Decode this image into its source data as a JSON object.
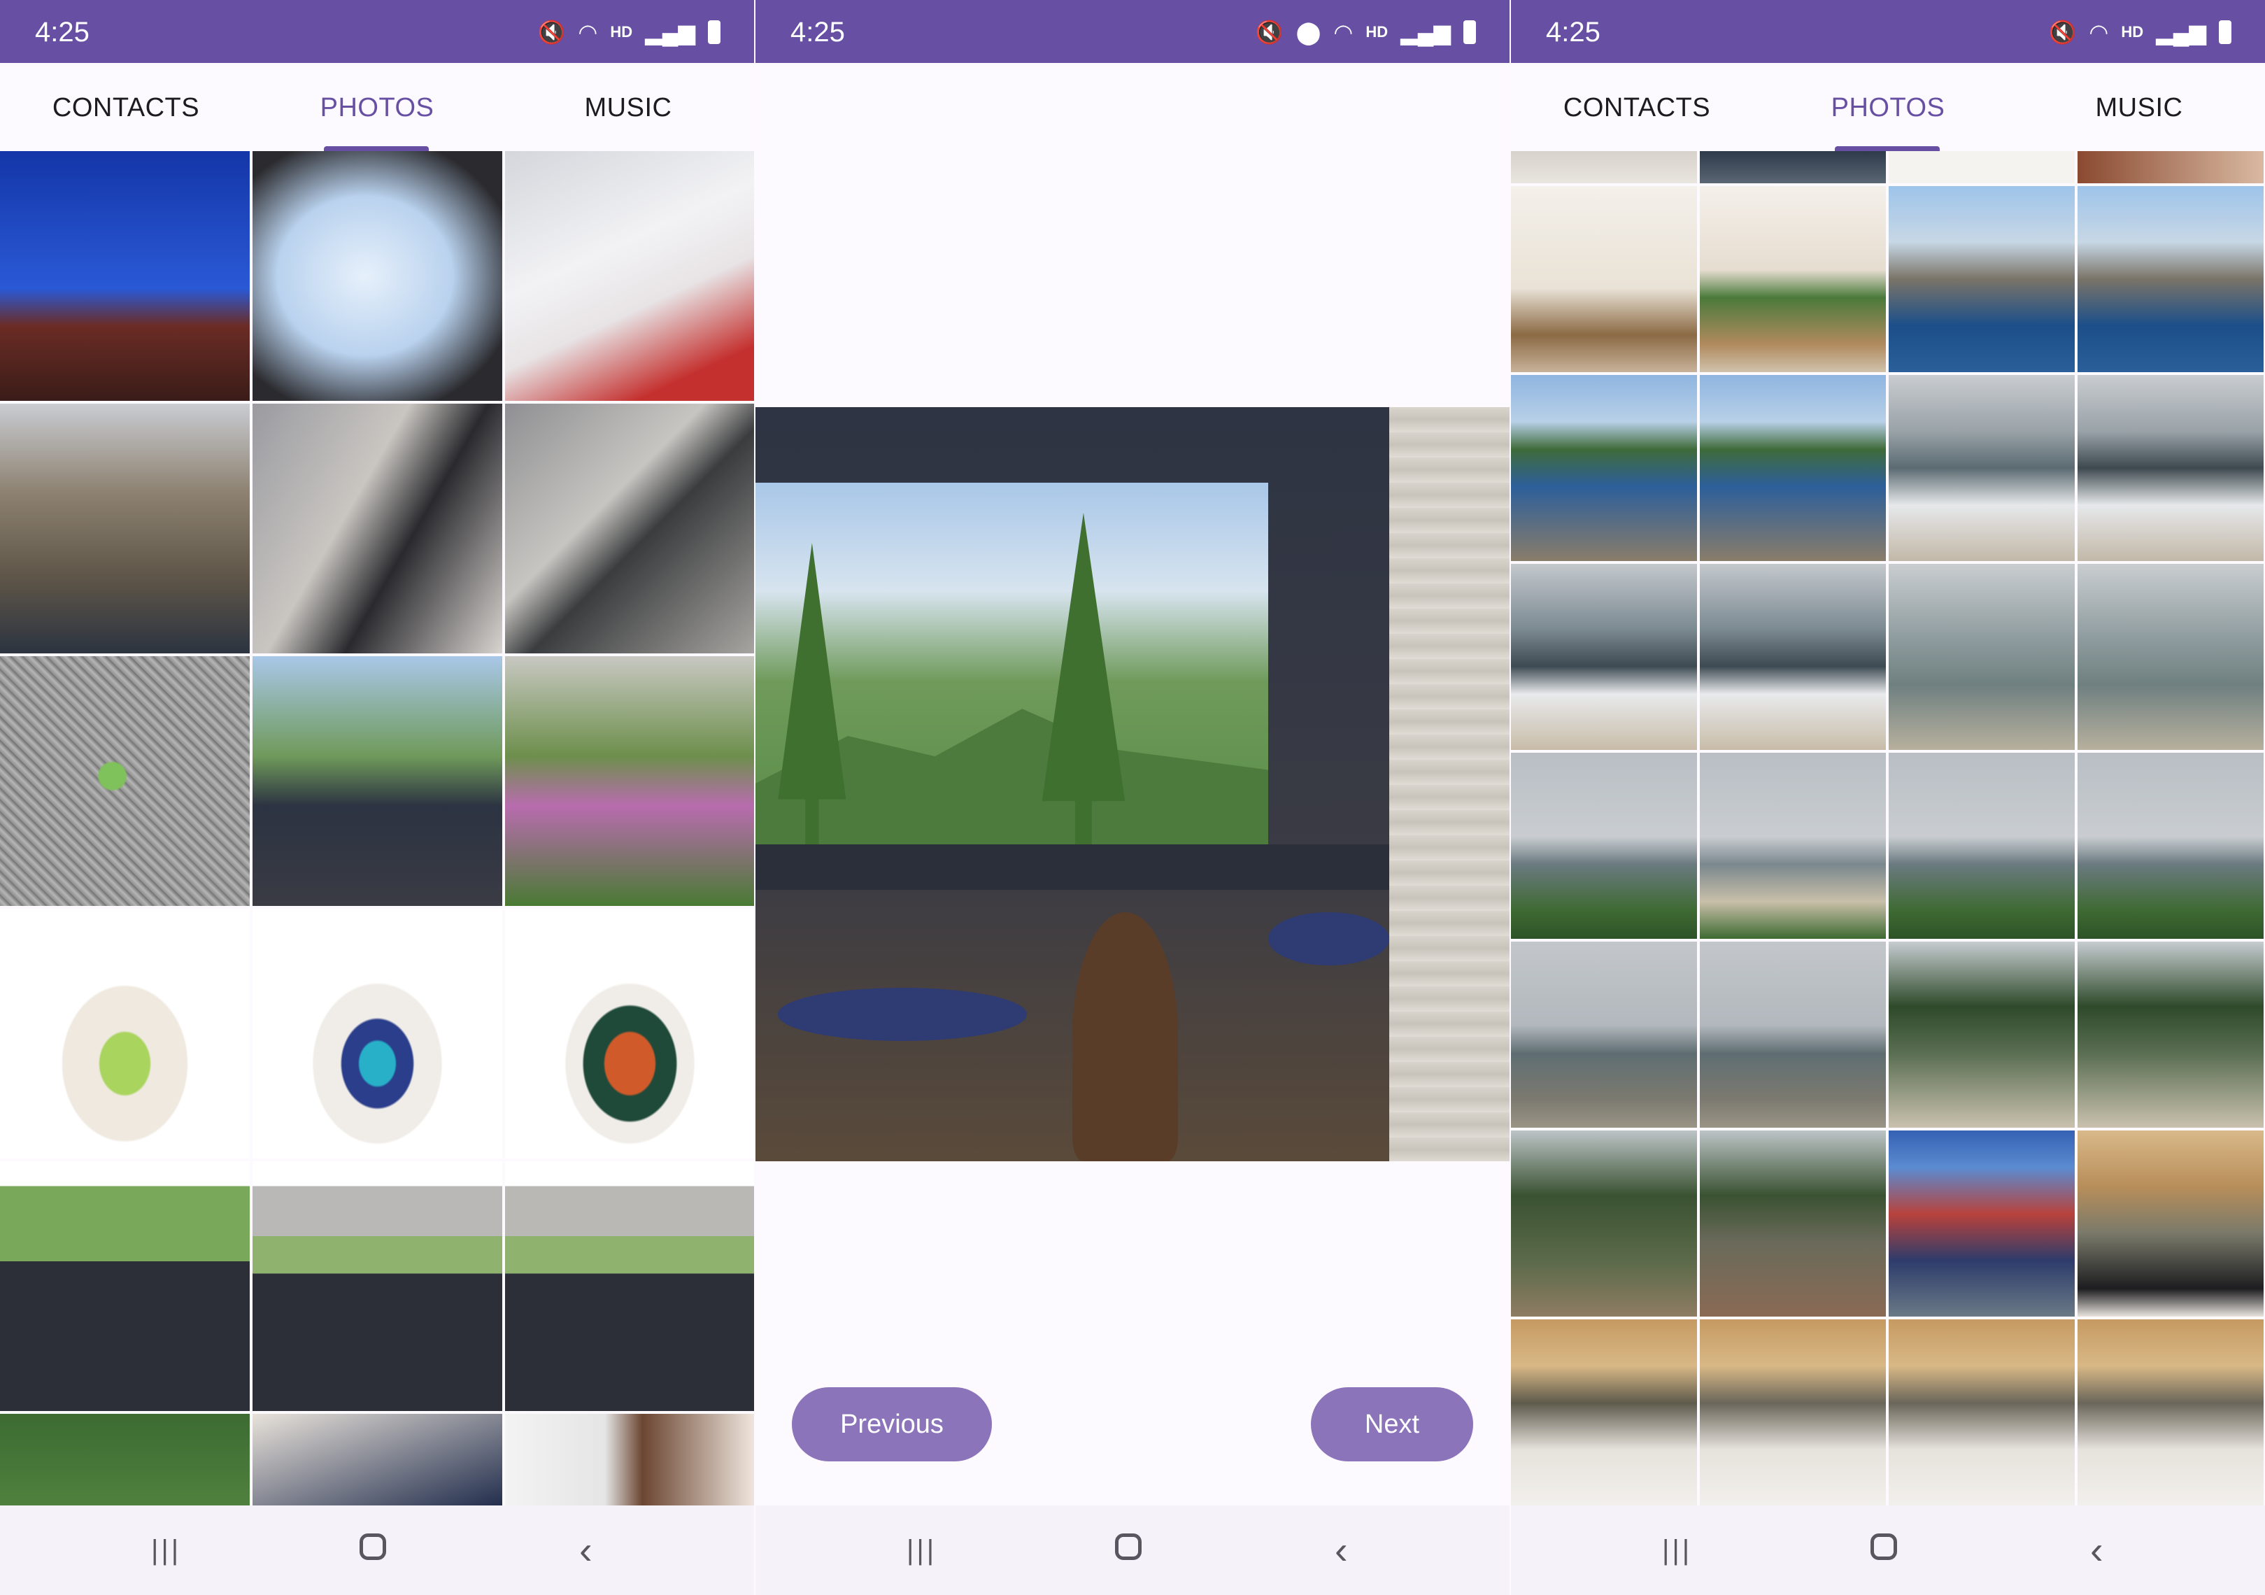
{
  "status_bar": {
    "time": "4:25",
    "hd_label": "HD",
    "icons": [
      "mute-icon",
      "location-icon",
      "wifi-icon",
      "hd-voice-icon",
      "signal-icon",
      "battery-icon"
    ]
  },
  "tabs": [
    {
      "label": "CONTACTS"
    },
    {
      "label": "PHOTOS"
    },
    {
      "label": "MUSIC"
    }
  ],
  "active_tab": "PHOTOS",
  "viewer": {
    "previous_label": "Previous",
    "next_label": "Next"
  },
  "nav_bar": {
    "icons": [
      "recents-icon",
      "home-icon",
      "back-icon"
    ]
  },
  "colors": {
    "brand": "#6750a4",
    "button": "#8c74bb",
    "background": "#fdfaff"
  },
  "phone1_photos": [
    "theater-stage",
    "casting-board",
    "ticket",
    "college-building",
    "girl-balcony",
    "floor-mat",
    "green-frog",
    "window-mountain",
    "garden-flowers",
    "sandal-green",
    "sandal-blue",
    "sandal-orange",
    "car-driver",
    "car-peace-sign",
    "car-interior",
    "forest-window",
    "girl-desk",
    "girl-wall"
  ],
  "phone3_photos": [
    "partial-top-1",
    "partial-top-2",
    "partial-top-3",
    "partial-top-4",
    "cafe-interior-1",
    "cafe-interior-2",
    "sea-rocks-1",
    "sea-rocks-2",
    "rocky-shore-1",
    "rocky-shore-2",
    "waves-rocks-1",
    "waves-rocks-2",
    "waves-1",
    "waves-2",
    "sea-calm-1",
    "sea-calm-2",
    "beach-pine-1",
    "beach-grass",
    "beach-pine-2",
    "beach-pine-3",
    "grey-sea-1",
    "grey-sea-2",
    "pine-forest-1",
    "pine-forest-2",
    "pine-forest-3",
    "rail-track",
    "rail-bike",
    "hotpot-1",
    "hotpot-2",
    "hotpot-3",
    "hotpot-4",
    "hotpot-5"
  ]
}
